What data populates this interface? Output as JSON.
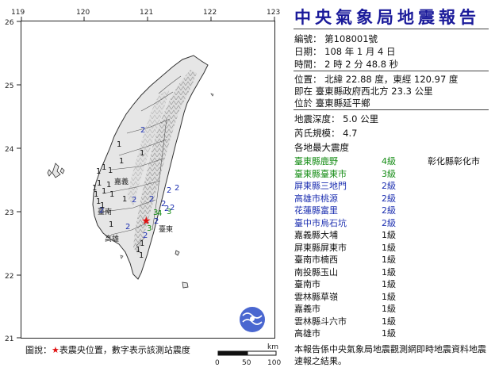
{
  "map": {
    "lon_ticks": [
      "119",
      "120",
      "121",
      "122",
      "123"
    ],
    "lat_ticks": [
      "26",
      "25",
      "24",
      "23",
      "22",
      "21"
    ],
    "place_labels": [
      "嘉義",
      "臺南",
      "高雄",
      "臺東"
    ],
    "intensity_marks": [
      "2",
      "1",
      "1",
      "1",
      "1",
      "1",
      "1",
      "1",
      "1",
      "1",
      "1",
      "1",
      "1",
      "2",
      "2",
      "2",
      "2",
      "2",
      "2",
      "2",
      "2",
      "3",
      "2",
      "3",
      "4",
      "3",
      "2",
      "2",
      "1",
      "1",
      "1",
      "1",
      "1",
      "1",
      "1"
    ],
    "epicenter_symbol": "★",
    "scale_unit": "km",
    "scale_ticks": [
      "0",
      "50",
      "100"
    ],
    "colors": {
      "sea": "#ffffff",
      "land": "#e8e8e8",
      "terrain": "#9a9a9a",
      "intensity_1": "#111111",
      "intensity_2": "#1c2fb0",
      "intensity_3": "#158c15",
      "intensity_4": "#158c15",
      "epicenter": "#e01010"
    }
  },
  "report": {
    "title": "中央氣象局地震報告",
    "number_line": "編號： 第108001號",
    "date_line": "日期： 108 年 1 月 4 日",
    "time_line": "時間： 2 時 2 分 48.8 秒",
    "location_line1": "位置： 北緯 22.88 度，東經 120.97 度",
    "location_line2": "即在 臺東縣政府西北方 23.3 公里",
    "location_line3": "位於 臺東縣延平鄉",
    "depth_line": "地震深度： 5.0 公里",
    "magnitude_line": "芮氏規模： 4.7",
    "intensity_header": "各地最大震度"
  },
  "intensities": [
    {
      "loc": "臺東縣鹿野",
      "lv": "4級",
      "color": "green",
      "loc2": "彰化縣彰化市",
      "lv2": "1級"
    },
    {
      "loc": "臺東縣臺東市",
      "lv": "3級",
      "color": "green"
    },
    {
      "loc": "屏東縣三地門",
      "lv": "2級",
      "color": "blue"
    },
    {
      "loc": "高雄市桃源",
      "lv": "2級",
      "color": "blue"
    },
    {
      "loc": "花蓮縣富里",
      "lv": "2級",
      "color": "blue"
    },
    {
      "loc": "臺中市烏石坑",
      "lv": "2級",
      "color": "blue"
    },
    {
      "loc": "嘉義縣大埔",
      "lv": "1級",
      "color": "black"
    },
    {
      "loc": "屏東縣屏東市",
      "lv": "1級",
      "color": "black"
    },
    {
      "loc": "臺南市楠西",
      "lv": "1級",
      "color": "black"
    },
    {
      "loc": "南投縣玉山",
      "lv": "1級",
      "color": "black"
    },
    {
      "loc": "臺南市",
      "lv": "1級",
      "color": "black"
    },
    {
      "loc": "雲林縣草嶺",
      "lv": "1級",
      "color": "black"
    },
    {
      "loc": "嘉義市",
      "lv": "1級",
      "color": "black"
    },
    {
      "loc": "雲林縣斗六市",
      "lv": "1級",
      "color": "black"
    },
    {
      "loc": "高雄市",
      "lv": "1級",
      "color": "black"
    }
  ],
  "legend": {
    "prefix": "圖說：",
    "star": "★",
    "text": "表震央位置，數字表示該測站震度"
  },
  "footnote": "本報告係中央氣象局地震觀測網即時地震資料地震速報之結果。"
}
